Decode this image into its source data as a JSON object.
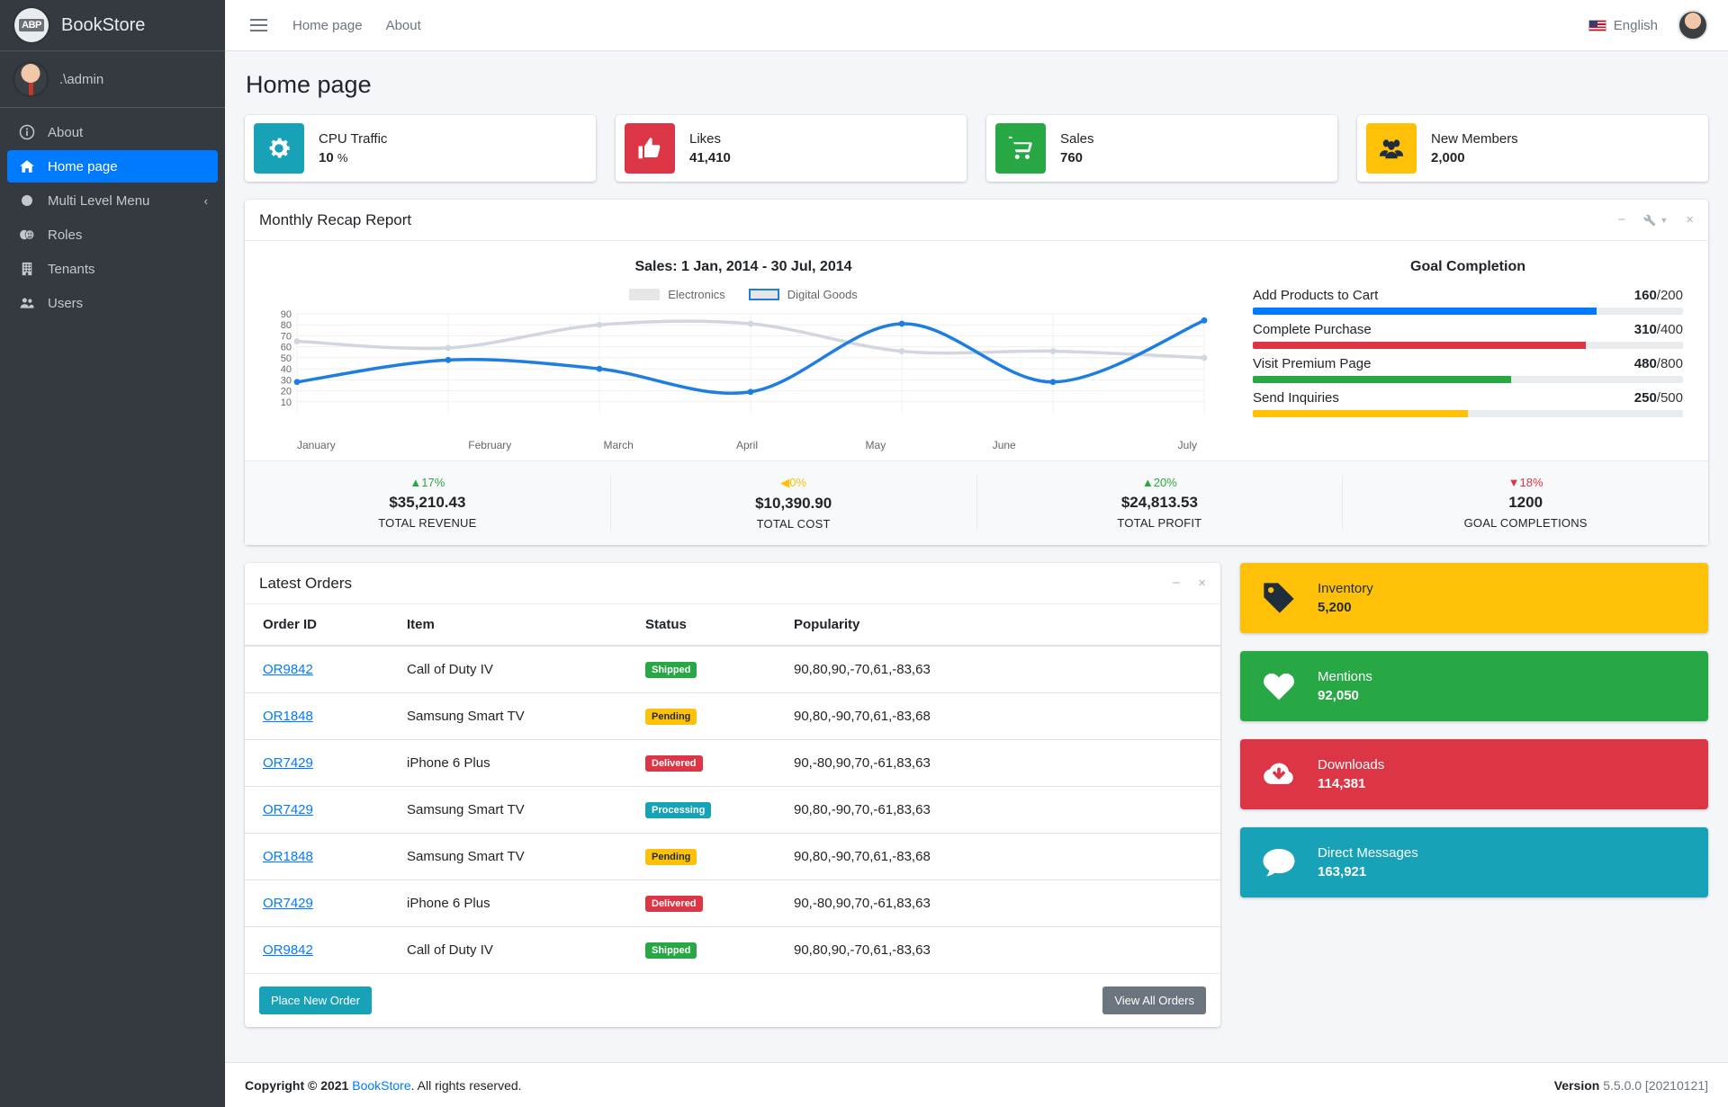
{
  "brand": {
    "title": "BookStore",
    "logo_text": "ABP"
  },
  "user_panel": {
    "name": ".\\admin"
  },
  "sidebar": {
    "items": [
      {
        "label": "About",
        "icon": "info-circle-icon",
        "active": false,
        "chevron": ""
      },
      {
        "label": "Home page",
        "icon": "home-icon",
        "active": true,
        "chevron": ""
      },
      {
        "label": "Multi Level Menu",
        "icon": "circle-icon",
        "active": false,
        "chevron": "‹"
      },
      {
        "label": "Roles",
        "icon": "theater-masks-icon",
        "active": false,
        "chevron": ""
      },
      {
        "label": "Tenants",
        "icon": "building-icon",
        "active": false,
        "chevron": ""
      },
      {
        "label": "Users",
        "icon": "users-icon",
        "active": false,
        "chevron": ""
      }
    ]
  },
  "topbar": {
    "links": [
      "Home page",
      "About"
    ],
    "language": "English",
    "menu_icon": "hamburger-icon",
    "flag_icon": "us-flag-icon"
  },
  "page": {
    "title": "Home page"
  },
  "info_boxes": [
    {
      "text": "CPU Traffic",
      "number": "10",
      "unit": "%",
      "color": "#17a2b8",
      "icon": "gear-icon"
    },
    {
      "text": "Likes",
      "number": "41,410",
      "unit": "",
      "color": "#dc3545",
      "icon": "thumbs-up-icon"
    },
    {
      "text": "Sales",
      "number": "760",
      "unit": "",
      "color": "#28a745",
      "icon": "shopping-cart-icon"
    },
    {
      "text": "New Members",
      "number": "2,000",
      "unit": "",
      "color": "#ffc107",
      "icon": "user-group-icon"
    }
  ],
  "recap_card": {
    "title": "Monthly Recap Report",
    "tools": {
      "minimize": "−",
      "wrench": "wrench-icon",
      "close": "×"
    }
  },
  "chart_data": {
    "type": "line",
    "title": "Sales: 1 Jan, 2014 - 30 Jul, 2014",
    "categories": [
      "January",
      "February",
      "March",
      "April",
      "May",
      "June",
      "July"
    ],
    "series": [
      {
        "name": "Electronics",
        "values": [
          65,
          59,
          80,
          81,
          56,
          56,
          50
        ],
        "color": "#d2d6de"
      },
      {
        "name": "Digital Goods",
        "values": [
          28,
          48,
          40,
          19,
          81,
          28,
          84
        ],
        "color": "#1e7ee0"
      }
    ],
    "ylim": [
      0,
      90
    ],
    "yticks": [
      90,
      80,
      70,
      60,
      50,
      40,
      30,
      20,
      10
    ],
    "xlabel": "",
    "ylabel": "",
    "grid": true,
    "legend_position": "top"
  },
  "goal_completion": {
    "title": "Goal Completion",
    "goals": [
      {
        "label": "Add Products to Cart",
        "current": "160",
        "total": "/200",
        "percent": 80,
        "color": "#007bff"
      },
      {
        "label": "Complete Purchase",
        "current": "310",
        "total": "/400",
        "percent": 77.5,
        "color": "#dc3545"
      },
      {
        "label": "Visit Premium Page",
        "current": "480",
        "total": "/800",
        "percent": 60,
        "color": "#28a745"
      },
      {
        "label": "Send Inquiries",
        "current": "250",
        "total": "/500",
        "percent": 50,
        "color": "#ffc107"
      }
    ]
  },
  "summary_stats": [
    {
      "arrow": "▲",
      "change": "17%",
      "change_color": "#28a745",
      "value": "$35,210.43",
      "label": "TOTAL REVENUE"
    },
    {
      "arrow": "◀",
      "change": "0%",
      "change_color": "#ffc107",
      "value": "$10,390.90",
      "label": "TOTAL COST"
    },
    {
      "arrow": "▲",
      "change": "20%",
      "change_color": "#28a745",
      "value": "$24,813.53",
      "label": "TOTAL PROFIT"
    },
    {
      "arrow": "▼",
      "change": "18%",
      "change_color": "#dc3545",
      "value": "1200",
      "label": "GOAL COMPLETIONS"
    }
  ],
  "orders_card": {
    "title": "Latest Orders",
    "tools": {
      "minimize": "−",
      "close": "×"
    },
    "columns": [
      "Order ID",
      "Item",
      "Status",
      "Popularity"
    ],
    "rows": [
      {
        "id": "OR9842",
        "item": "Call of Duty IV",
        "status": "Shipped",
        "status_color": "#28a745",
        "popularity": "90,80,90,-70,61,-83,63"
      },
      {
        "id": "OR1848",
        "item": "Samsung Smart TV",
        "status": "Pending",
        "status_color": "#ffc107",
        "popularity": "90,80,-90,70,61,-83,68"
      },
      {
        "id": "OR7429",
        "item": "iPhone 6 Plus",
        "status": "Delivered",
        "status_color": "#dc3545",
        "popularity": "90,-80,90,70,-61,83,63"
      },
      {
        "id": "OR7429",
        "item": "Samsung Smart TV",
        "status": "Processing",
        "status_color": "#17a2b8",
        "popularity": "90,80,-90,70,-61,83,63"
      },
      {
        "id": "OR1848",
        "item": "Samsung Smart TV",
        "status": "Pending",
        "status_color": "#ffc107",
        "popularity": "90,80,-90,70,61,-83,68"
      },
      {
        "id": "OR7429",
        "item": "iPhone 6 Plus",
        "status": "Delivered",
        "status_color": "#dc3545",
        "popularity": "90,-80,90,70,-61,83,63"
      },
      {
        "id": "OR9842",
        "item": "Call of Duty IV",
        "status": "Shipped",
        "status_color": "#28a745",
        "popularity": "90,80,90,-70,61,-83,63"
      }
    ],
    "place_order_label": "Place New Order",
    "view_all_label": "View All Orders"
  },
  "big_boxes": [
    {
      "text": "Inventory",
      "number": "5,200",
      "color": "#ffc107",
      "text_color": "#1f2d3d",
      "icon": "tag-icon"
    },
    {
      "text": "Mentions",
      "number": "92,050",
      "color": "#28a745",
      "text_color": "#ffffff",
      "icon": "heart-icon"
    },
    {
      "text": "Downloads",
      "number": "114,381",
      "color": "#dc3545",
      "text_color": "#ffffff",
      "icon": "cloud-download-icon"
    },
    {
      "text": "Direct Messages",
      "number": "163,921",
      "color": "#17a2b8",
      "text_color": "#ffffff",
      "icon": "comment-icon"
    }
  ],
  "footer": {
    "copyright_prefix": "Copyright © 2021 ",
    "brand_link": "BookStore",
    "copyright_suffix": ". All rights reserved.",
    "version_label": "Version",
    "version_value": " 5.5.0.0 [20210121]"
  }
}
